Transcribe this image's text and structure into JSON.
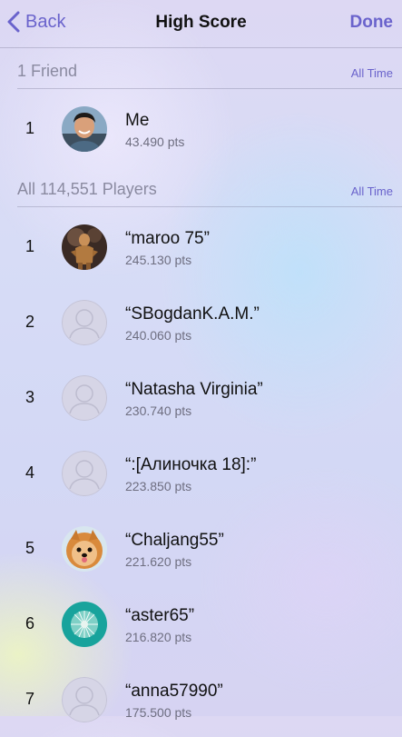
{
  "nav": {
    "back_label": "Back",
    "title": "High Score",
    "done_label": "Done"
  },
  "friends_section": {
    "title": "1 Friend",
    "filter": "All Time",
    "rows": [
      {
        "rank": "1",
        "name": "Me",
        "score": "43.490 pts",
        "avatar": "photo-man-smiling"
      }
    ]
  },
  "players_section": {
    "title": "All 114,551 Players",
    "filter": "All Time",
    "rows": [
      {
        "rank": "1",
        "name": "“maroo 75”",
        "score": "245.130 pts",
        "avatar": "photo-figure-statue"
      },
      {
        "rank": "2",
        "name": "“SBogdanK.A.M.”",
        "score": "240.060 pts",
        "avatar": "default-person"
      },
      {
        "rank": "3",
        "name": "“Natasha Virginia”",
        "score": "230.740 pts",
        "avatar": "default-person"
      },
      {
        "rank": "4",
        "name": "“:[Алиночка 18]:”",
        "score": "223.850 pts",
        "avatar": "default-person"
      },
      {
        "rank": "5",
        "name": "“Chaljang55”",
        "score": "221.620 pts",
        "avatar": "photo-pomeranian-dog"
      },
      {
        "rank": "6",
        "name": "“aster65”",
        "score": "216.820 pts",
        "avatar": "photo-dandelion-teal"
      },
      {
        "rank": "7",
        "name": "“anna57990”",
        "score": "175.500 pts",
        "avatar": "default-person"
      }
    ]
  },
  "colors": {
    "accent": "#6a63cc",
    "section_text": "#8a8aa0",
    "score_text": "#6e6e80"
  }
}
